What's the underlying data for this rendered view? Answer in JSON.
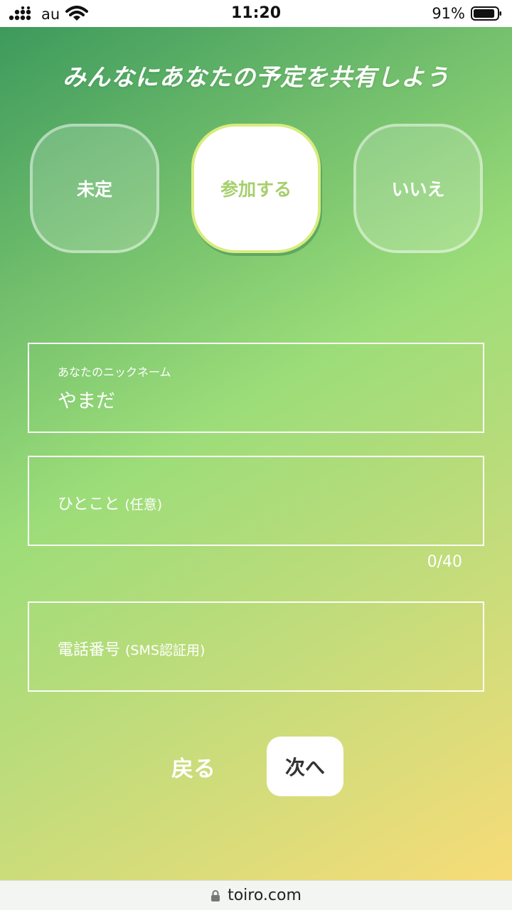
{
  "status_bar": {
    "carrier": "au",
    "time": "11:20",
    "battery_percent": "91%",
    "battery_level": 0.91,
    "icons": [
      "signal-icon",
      "wifi-icon",
      "battery-icon"
    ]
  },
  "headline": "みんなにあなたの予定を共有しよう",
  "choices": [
    {
      "label": "未定",
      "selected": false
    },
    {
      "label": "参加する",
      "selected": true
    },
    {
      "label": "いいえ",
      "selected": false
    }
  ],
  "nickname_field": {
    "label": "あなたのニックネーム",
    "value": "やまだ"
  },
  "comment_field": {
    "placeholder_main": "ひとこと",
    "placeholder_sub": "(任意)",
    "counter": "0/40"
  },
  "phone_field": {
    "placeholder_main": "電話番号",
    "placeholder_sub": "(SMS認証用)"
  },
  "buttons": {
    "back": "戻る",
    "next": "次へ"
  },
  "url_bar": {
    "url": "toiro.com",
    "icon": "lock-icon"
  },
  "colors": {
    "selected_text": "#a6cf6c",
    "gradient_start": "#3d9a5c",
    "gradient_end": "#f7dc78"
  }
}
